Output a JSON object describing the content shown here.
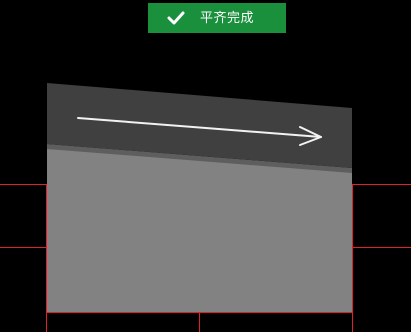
{
  "toast": {
    "message": "平齐完成",
    "icon": "check-icon",
    "background_color": "#1a8f3c",
    "text_color": "#ffffff"
  },
  "viewport": {
    "background_color": "#000000",
    "guide_line_color": "#e0202a",
    "panel": {
      "top_face_color": "#404040",
      "edge_strip_color": "#5e5e5e",
      "front_face_color": "#828282"
    },
    "direction_arrow": {
      "icon": "arrow-right-icon",
      "color": "#f2f2f2"
    }
  }
}
